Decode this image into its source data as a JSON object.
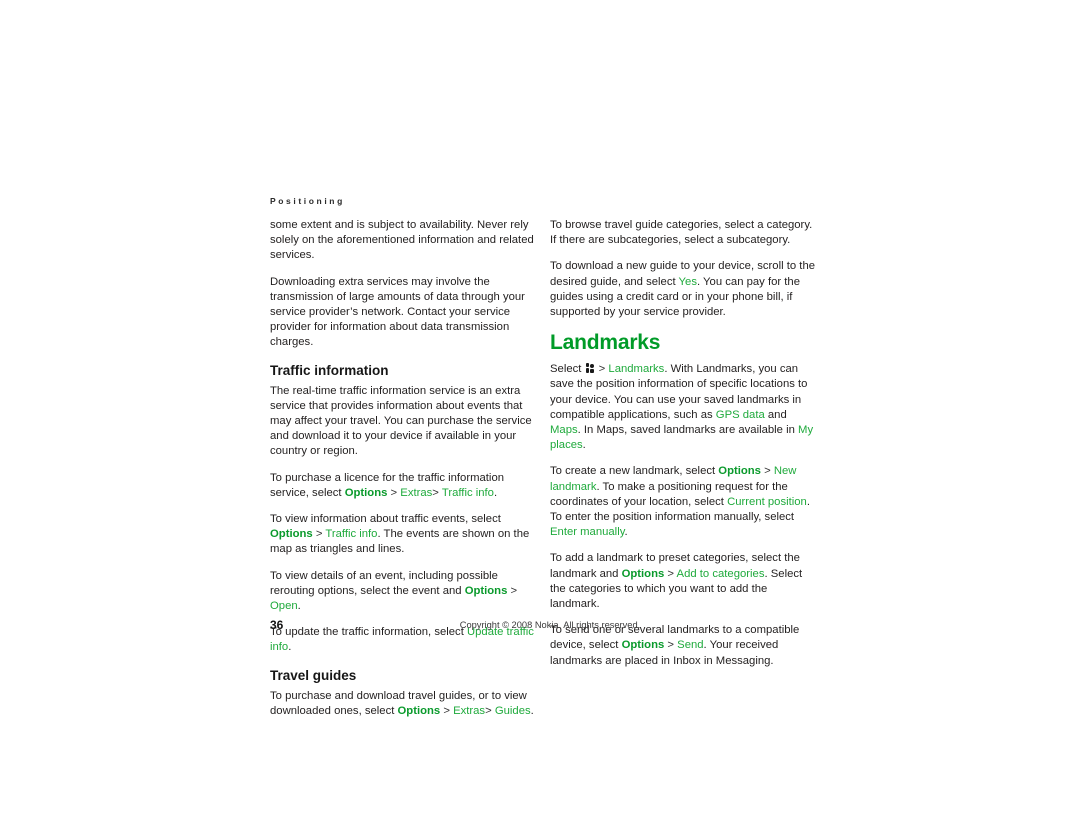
{
  "running_header": "Positioning",
  "left_column": {
    "para_1": "some extent and is subject to availability. Never rely solely on the aforementioned information and related services.",
    "para_2": "Downloading extra services may involve the transmission of large amounts of data through your service provider’s network. Contact your service provider for information about data transmission charges.",
    "heading_traffic": "Traffic information",
    "para_3": "The real-time traffic information service is an extra service that provides information about events that may affect your travel. You can purchase the service and download it to your device if available in your country or region.",
    "para_4_a": "To purchase a licence for the traffic information service, select ",
    "para_4_options": "Options",
    "para_4_sep1": " > ",
    "para_4_extras": "Extras",
    "para_4_sep2": "> ",
    "para_4_traffic_info": "Traffic info",
    "para_4_end": ".",
    "para_5_a": "To view information about traffic events, select ",
    "para_5_options": "Options",
    "para_5_sep": " > ",
    "para_5_traffic_info": "Traffic info",
    "para_5_b": ". The events are shown on the map as triangles and lines.",
    "para_6_a": "To view details of an event, including possible rerouting options, select the event and ",
    "para_6_options": "Options",
    "para_6_sep": " > ",
    "para_6_open": "Open",
    "para_6_end": ".",
    "para_7_a": "To update the traffic information, select ",
    "para_7_update": "Update traffic info",
    "para_7_end": ".",
    "heading_guides": "Travel guides",
    "para_8_a": "To purchase and download travel guides, or to view downloaded ones, select ",
    "para_8_options": "Options",
    "para_8_sep1": " > ",
    "para_8_extras": "Extras",
    "para_8_sep2": "> ",
    "para_8_guides": "Guides",
    "para_8_end": "."
  },
  "right_column": {
    "para_1": "To browse travel guide categories, select a category. If there are subcategories, select a subcategory.",
    "para_2_a": "To download a new guide to your device, scroll to the desired guide, and select ",
    "para_2_yes": "Yes",
    "para_2_b": ". You can pay for the guides using a credit card or in your phone bill, if supported by your service provider.",
    "heading_landmarks": "Landmarks",
    "para_3_select": "Select ",
    "menu_key_icon": "menu-key-icon",
    "para_3_sep": " > ",
    "para_3_landmarks": "Landmarks",
    "para_3_b": ". With Landmarks, you can save the position information of specific locations to your device. You can use your saved landmarks in compatible applications, such as ",
    "para_3_gps": "GPS data",
    "para_3_c": " and ",
    "para_3_maps": "Maps",
    "para_3_d": ". In Maps, saved landmarks are available in ",
    "para_3_myplaces": "My places",
    "para_3_end": ".",
    "para_4_a": "To create a new landmark, select ",
    "para_4_options": "Options",
    "para_4_sep": " > ",
    "para_4_new_landmark": "New landmark",
    "para_4_b": ". To make a positioning request for the coordinates of your location, select ",
    "para_4_current_position": "Current position",
    "para_4_c": ". To enter the position information manually, select ",
    "para_4_enter_manually": "Enter manually",
    "para_4_end": ".",
    "para_5_a": "To add a landmark to preset categories, select the landmark and ",
    "para_5_options": "Options",
    "para_5_sep": " > ",
    "para_5_add_to_categories": "Add to categories",
    "para_5_b": ". Select the categories to which you want to add the landmark.",
    "para_6_a": "To send one or several landmarks to a compatible device, select ",
    "para_6_options": "Options",
    "para_6_sep": " > ",
    "para_6_send": "Send",
    "para_6_b": ". Your received landmarks are placed in Inbox in Messaging."
  },
  "footer": {
    "page_number": "36",
    "copyright": "Copyright © 2008 Nokia. All rights reserved."
  },
  "colors": {
    "accent_green": "#1faa3c",
    "heading_green": "#009b28",
    "body_text": "#221f1f",
    "page_background": "#ffffff"
  }
}
